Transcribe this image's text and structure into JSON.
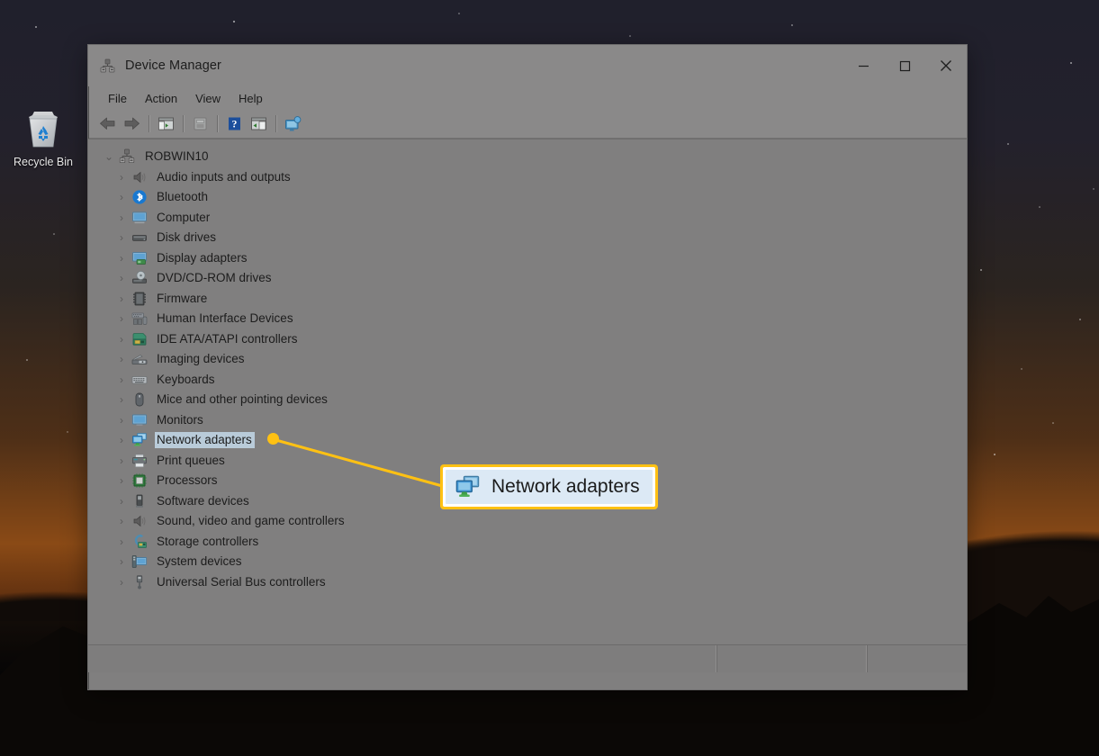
{
  "desktop": {
    "wallpaper_description": "night-sky-mountains",
    "colors": {
      "sky_top": "#20202c",
      "horizon_glow": "#8a4a16",
      "ground": "#080606"
    },
    "icons": [
      {
        "name": "recycle-bin",
        "label": "Recycle Bin"
      }
    ]
  },
  "window": {
    "title": "Device Manager",
    "title_icon": "device-manager-icon",
    "controls": {
      "minimize": "—",
      "maximize": "□",
      "close": "✕"
    },
    "menu": [
      {
        "label": "File"
      },
      {
        "label": "Action"
      },
      {
        "label": "View"
      },
      {
        "label": "Help"
      }
    ],
    "toolbar": [
      {
        "name": "back-button",
        "icon": "back-arrow-icon",
        "enabled": true
      },
      {
        "name": "forward-button",
        "icon": "forward-arrow-icon",
        "enabled": true
      },
      {
        "name": "separator-1",
        "icon": "separator",
        "enabled": false
      },
      {
        "name": "show-console-tree-button",
        "icon": "console-tree-icon",
        "enabled": true
      },
      {
        "name": "separator-2",
        "icon": "separator",
        "enabled": false
      },
      {
        "name": "properties-button",
        "icon": "properties-icon",
        "enabled": false
      },
      {
        "name": "separator-3",
        "icon": "separator",
        "enabled": false
      },
      {
        "name": "help-button",
        "icon": "help-question-icon",
        "enabled": true
      },
      {
        "name": "scan-hardware-changes-button",
        "icon": "scan-hardware-icon",
        "enabled": true
      },
      {
        "name": "separator-4",
        "icon": "separator",
        "enabled": false
      },
      {
        "name": "update-driver-button",
        "icon": "monitor-update-icon",
        "enabled": true
      }
    ],
    "status_bar": {
      "text": ""
    }
  },
  "tree": {
    "root": {
      "label": "ROBWIN10",
      "icon": "computer-node-icon",
      "expanded": true
    },
    "items": [
      {
        "label": "Audio inputs and outputs",
        "icon": "speaker-icon"
      },
      {
        "label": "Bluetooth",
        "icon": "bluetooth-icon"
      },
      {
        "label": "Computer",
        "icon": "computer-icon"
      },
      {
        "label": "Disk drives",
        "icon": "disk-drive-icon"
      },
      {
        "label": "Display adapters",
        "icon": "display-adapter-icon"
      },
      {
        "label": "DVD/CD-ROM drives",
        "icon": "dvd-drive-icon"
      },
      {
        "label": "Firmware",
        "icon": "firmware-chip-icon"
      },
      {
        "label": "Human Interface Devices",
        "icon": "hid-icon"
      },
      {
        "label": "IDE ATA/ATAPI controllers",
        "icon": "ide-controller-icon"
      },
      {
        "label": "Imaging devices",
        "icon": "imaging-device-icon"
      },
      {
        "label": "Keyboards",
        "icon": "keyboard-icon"
      },
      {
        "label": "Mice and other pointing devices",
        "icon": "mouse-icon"
      },
      {
        "label": "Monitors",
        "icon": "monitor-icon"
      },
      {
        "label": "Network adapters",
        "icon": "network-adapter-icon",
        "selected": true
      },
      {
        "label": "Print queues",
        "icon": "printer-icon"
      },
      {
        "label": "Processors",
        "icon": "processor-icon"
      },
      {
        "label": "Software devices",
        "icon": "software-device-icon"
      },
      {
        "label": "Sound, video and game controllers",
        "icon": "sound-controller-icon"
      },
      {
        "label": "Storage controllers",
        "icon": "storage-controller-icon"
      },
      {
        "label": "System devices",
        "icon": "system-device-icon"
      },
      {
        "label": "Universal Serial Bus controllers",
        "icon": "usb-icon"
      }
    ],
    "expander_collapsed_glyph": "›",
    "expander_expanded_glyph": "⌄"
  },
  "callout": {
    "label": "Network adapters",
    "icon": "network-adapter-icon",
    "border_color": "#ffc113",
    "background_color": "#dce9f5",
    "target_dot_color": "#ffc113"
  }
}
